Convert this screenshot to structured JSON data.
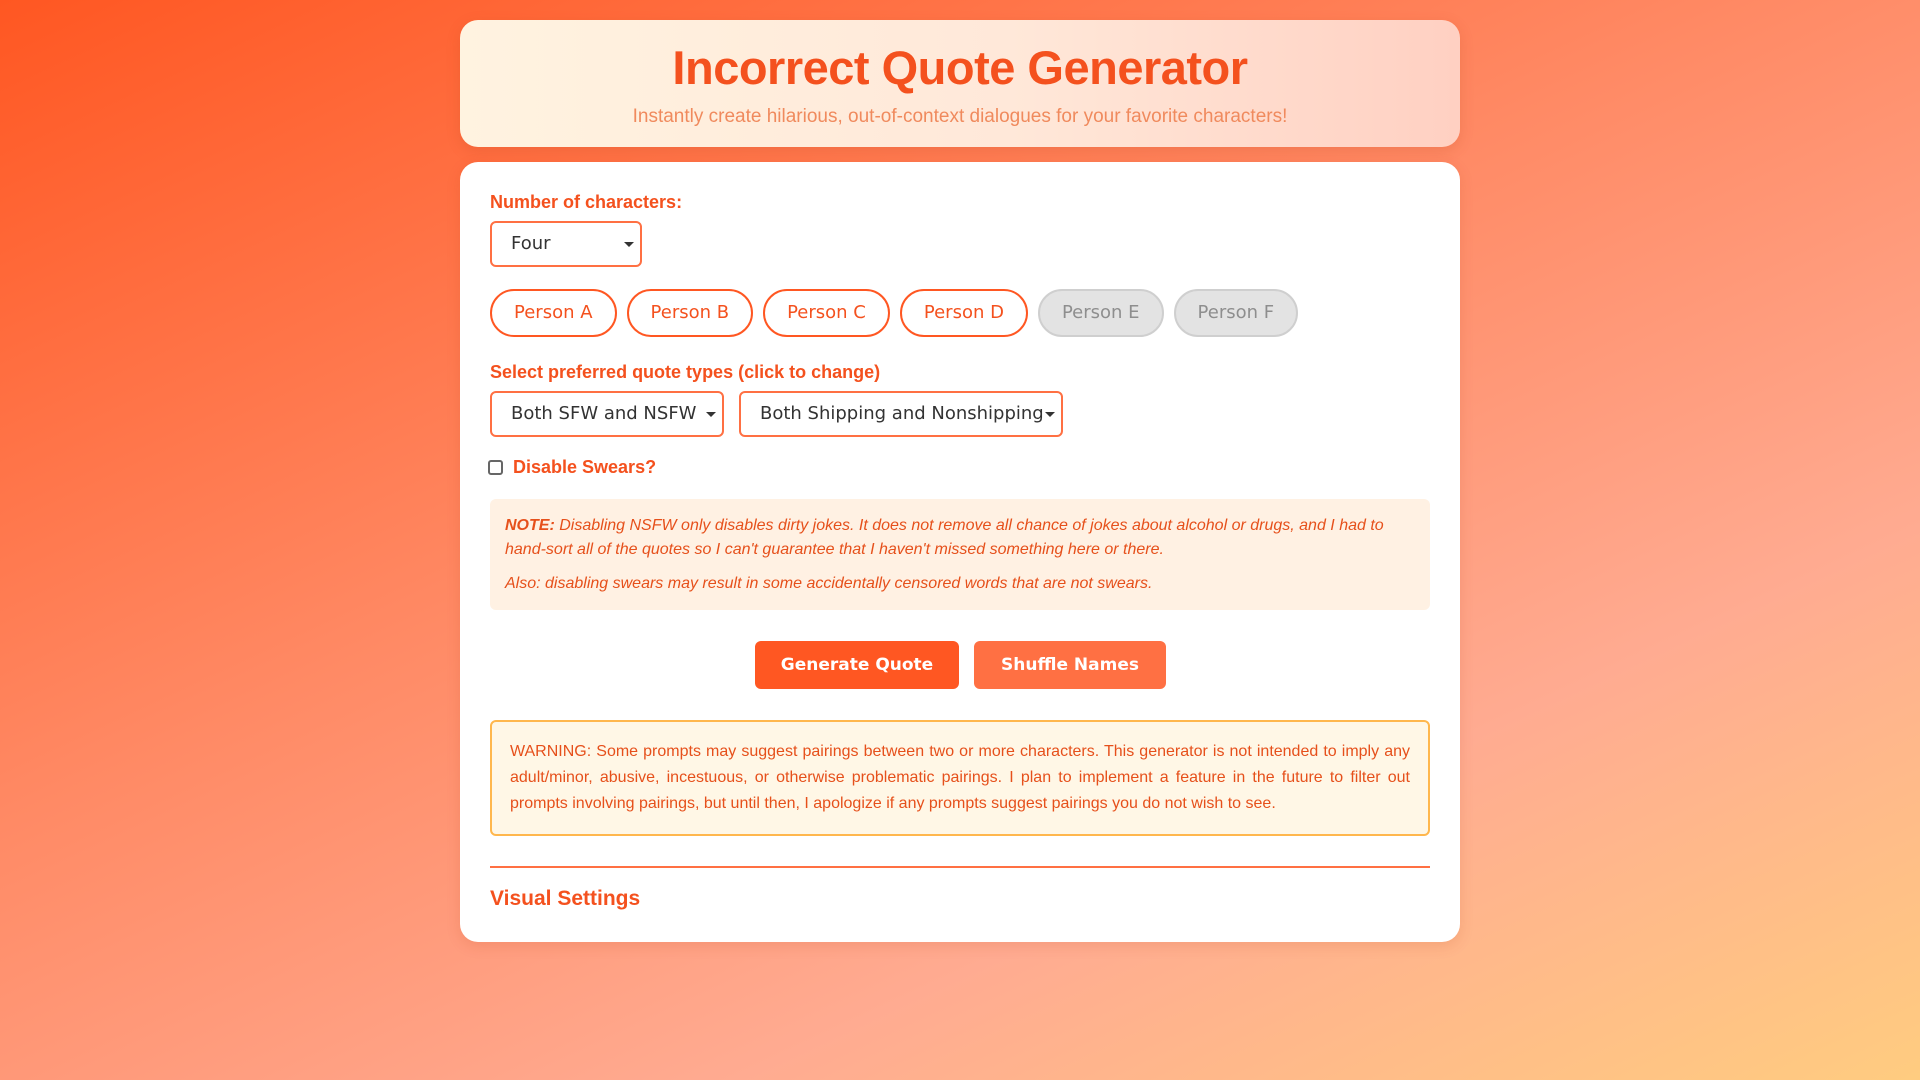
{
  "header": {
    "title": "Incorrect Quote Generator",
    "subtitle": "Instantly create hilarious, out-of-context dialogues for your favorite characters!"
  },
  "characters": {
    "label": "Number of characters:",
    "selected": "Four",
    "persons": [
      {
        "label": "Person A",
        "enabled": true
      },
      {
        "label": "Person B",
        "enabled": true
      },
      {
        "label": "Person C",
        "enabled": true
      },
      {
        "label": "Person D",
        "enabled": true
      },
      {
        "label": "Person E",
        "enabled": false
      },
      {
        "label": "Person F",
        "enabled": false
      }
    ]
  },
  "quote_types": {
    "label": "Select preferred quote types (click to change)",
    "sfw_selected": "Both SFW and NSFW",
    "shipping_selected": "Both Shipping and Nonshipping"
  },
  "swears": {
    "label": "Disable Swears?",
    "checked": false
  },
  "note": {
    "prefix": "NOTE:",
    "text1": "Disabling NSFW only disables dirty jokes. It does not remove all chance of jokes about alcohol or drugs, and I had to hand-sort all of the quotes so I can't guarantee that I haven't missed something here or there.",
    "text2": "Also: disabling swears may result in some accidentally censored words that are not swears."
  },
  "buttons": {
    "generate": "Generate Quote",
    "shuffle": "Shuffle Names"
  },
  "warning": "WARNING: Some prompts may suggest pairings between two or more characters. This generator is not intended to imply any adult/minor, abusive, incestuous, or otherwise problematic pairings. I plan to implement a feature in the future to filter out prompts involving pairings, but until then, I apologize if any prompts suggest pairings you do not wish to see.",
  "visual_settings": "Visual Settings",
  "colors": {
    "accent": "#ff5722",
    "accent_text": "#f4511e",
    "disabled_bg": "#e3e3e3",
    "warning_border": "#ffb74d"
  }
}
